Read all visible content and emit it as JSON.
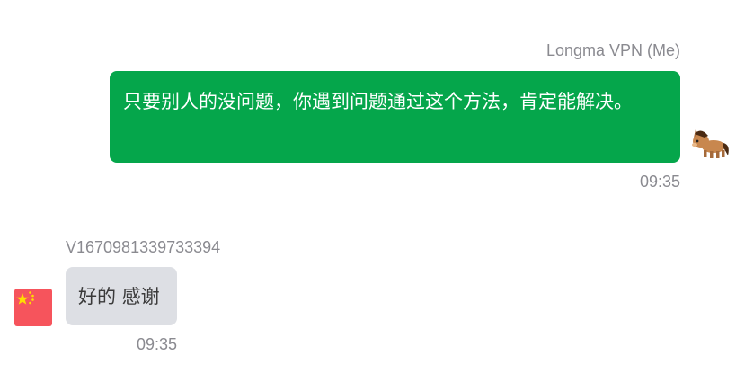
{
  "messages": [
    {
      "direction": "outgoing",
      "sender": "Longma VPN (Me)",
      "text": "只要别人的没问题，你遇到问题通过这个方法，肯定能解决。",
      "time": "09:35",
      "avatar_icon": "pony-icon",
      "bubble_color": "#05a64b"
    },
    {
      "direction": "incoming",
      "sender": "V1670981339733394",
      "text": "好的 感谢",
      "time": "09:35",
      "avatar_icon": "china-flag-icon",
      "bubble_color": "#dddfe4"
    }
  ]
}
